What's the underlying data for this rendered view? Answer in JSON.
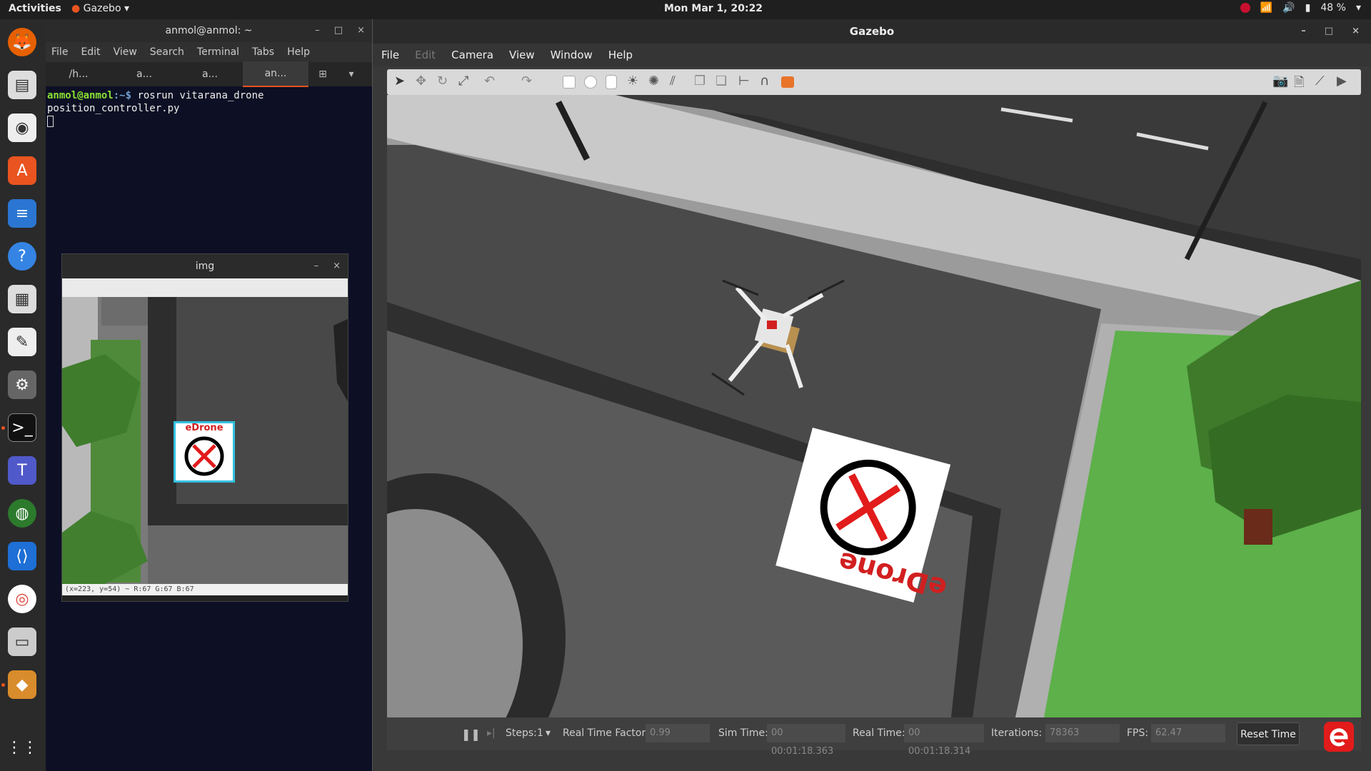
{
  "topbar": {
    "activities": "Activities",
    "app_name": "Gazebo",
    "clock": "Mon Mar  1, 20:22",
    "battery": "48 %"
  },
  "terminal": {
    "title": "anmol@anmol: ~",
    "menu": [
      "File",
      "Edit",
      "View",
      "Search",
      "Terminal",
      "Tabs",
      "Help"
    ],
    "tabs": [
      "/h...",
      "a...",
      "a...",
      "an..."
    ],
    "prompt_user": "anmol@anmol",
    "prompt_path": ":~$",
    "command": " rosrun vitarana_drone position_controller.py"
  },
  "img_window": {
    "title": "img",
    "status": "(x=223, y=54) ~ R:67 G:67 B:67",
    "marker_text": "eDrone"
  },
  "gazebo": {
    "title": "Gazebo",
    "menu": [
      "File",
      "Edit",
      "Camera",
      "View",
      "Window",
      "Help"
    ],
    "steps_label": "Steps:",
    "steps_value": "1",
    "rtf_label": "Real Time Factor:",
    "rtf_value": "0.99",
    "sim_time_label": "Sim Time:",
    "sim_time_value": "00 00:01:18.363",
    "real_time_label": "Real Time:",
    "real_time_value": "00 00:01:18.314",
    "iterations_label": "Iterations:",
    "iterations_value": "78363",
    "fps_label": "FPS:",
    "fps_value": "62.47",
    "reset_label": "Reset Time",
    "marker_text": "eDrone"
  },
  "colors": {
    "ubuntu_orange": "#e95420",
    "marker_red": "#e21b1b",
    "grass": "#5db04a"
  }
}
